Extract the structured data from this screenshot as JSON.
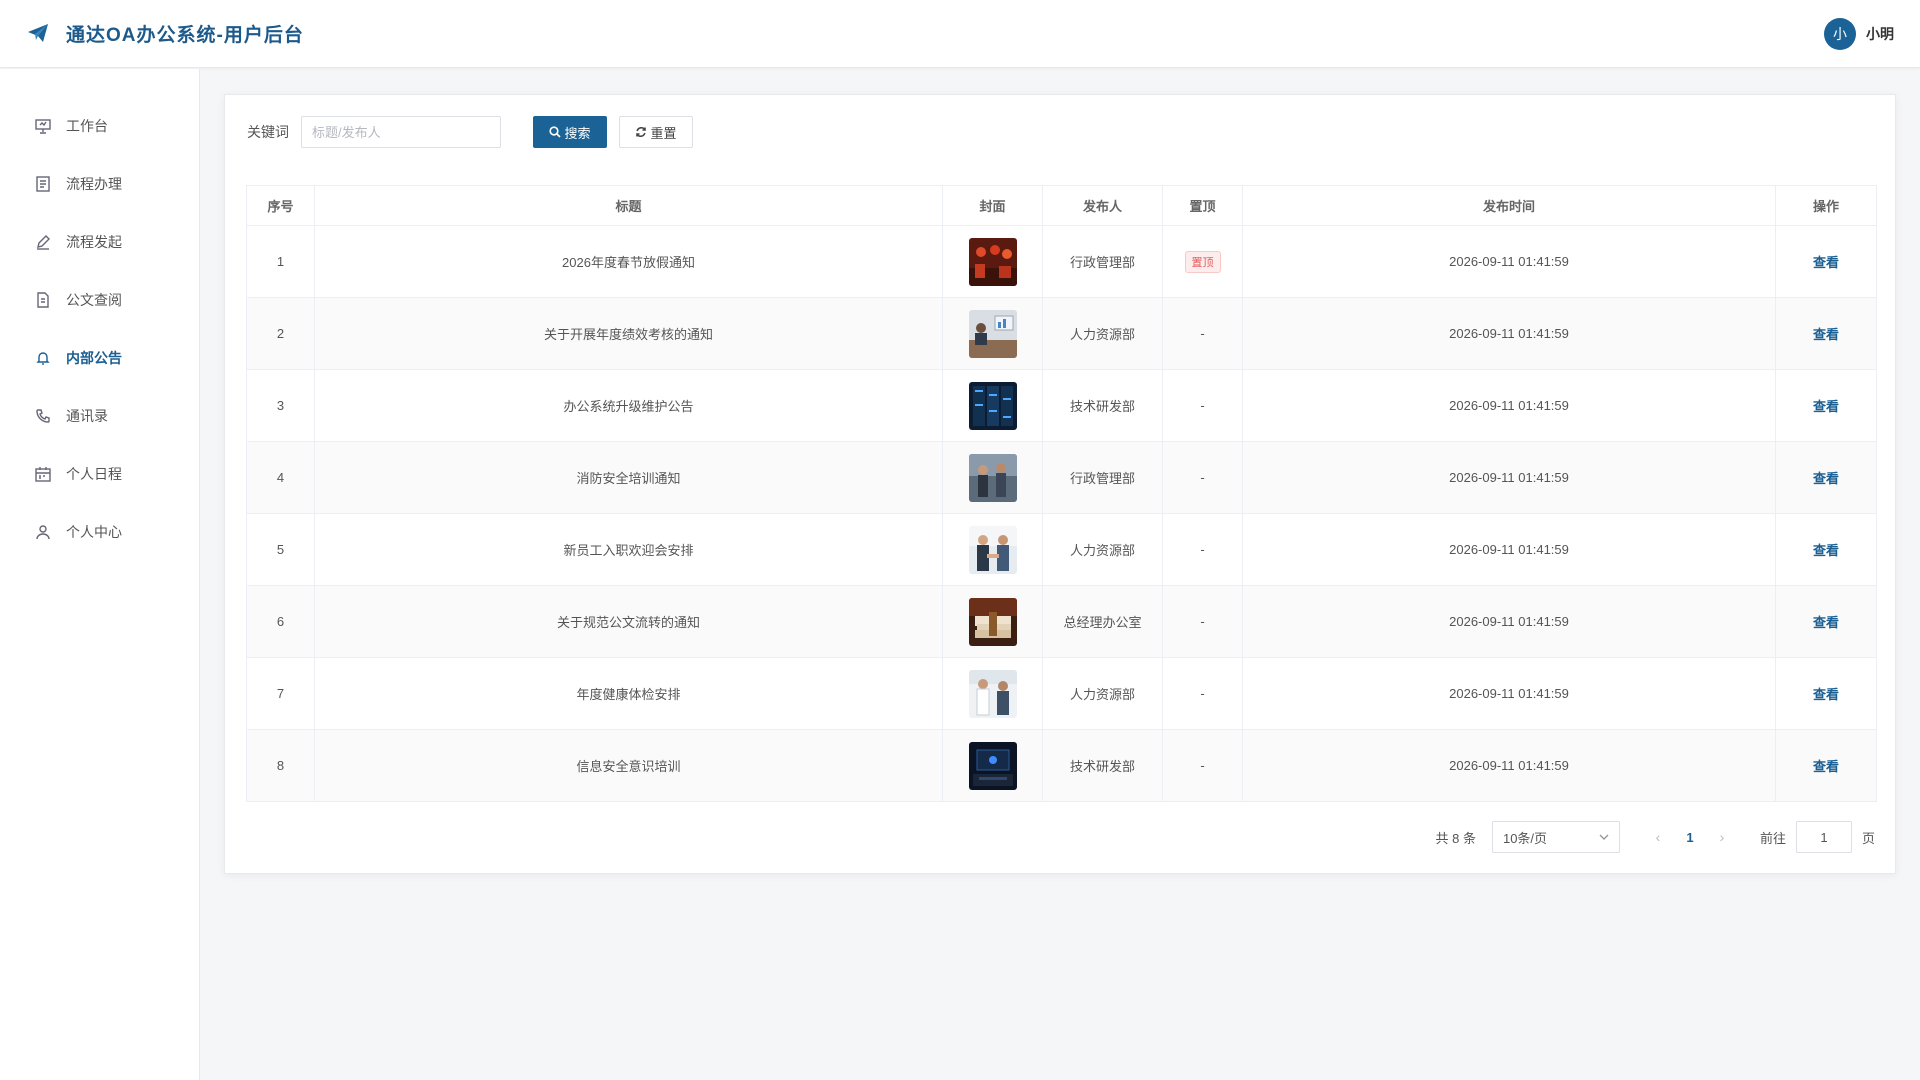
{
  "header": {
    "title": "通达OA办公系统-用户后台",
    "user_avatar_text": "小",
    "user_name": "小明"
  },
  "sidebar": {
    "items": [
      {
        "label": "工作台",
        "icon": "presentation-icon",
        "active": false
      },
      {
        "label": "流程办理",
        "icon": "document-list-icon",
        "active": false
      },
      {
        "label": "流程发起",
        "icon": "pen-icon",
        "active": false
      },
      {
        "label": "公文查阅",
        "icon": "file-icon",
        "active": false
      },
      {
        "label": "内部公告",
        "icon": "bell-icon",
        "active": true
      },
      {
        "label": "通讯录",
        "icon": "phone-icon",
        "active": false
      },
      {
        "label": "个人日程",
        "icon": "calendar-icon",
        "active": false
      },
      {
        "label": "个人中心",
        "icon": "user-icon",
        "active": false
      }
    ]
  },
  "search": {
    "label": "关键词",
    "placeholder": "标题/发布人",
    "value": "",
    "search_button": "搜索",
    "reset_button": "重置"
  },
  "table": {
    "columns": [
      "序号",
      "标题",
      "封面",
      "发布人",
      "置顶",
      "发布时间",
      "操作"
    ],
    "rows": [
      {
        "index": "1",
        "title": "2026年度春节放假通知",
        "publisher": "行政管理部",
        "pinned": "置顶",
        "is_pinned": true,
        "time": "2026-09-11 01:41:59",
        "action": "查看",
        "cover": "festival"
      },
      {
        "index": "2",
        "title": "关于开展年度绩效考核的通知",
        "publisher": "人力资源部",
        "pinned": "-",
        "is_pinned": false,
        "time": "2026-09-11 01:41:59",
        "action": "查看",
        "cover": "meeting"
      },
      {
        "index": "3",
        "title": "办公系统升级维护公告",
        "publisher": "技术研发部",
        "pinned": "-",
        "is_pinned": false,
        "time": "2026-09-11 01:41:59",
        "action": "查看",
        "cover": "server"
      },
      {
        "index": "4",
        "title": "消防安全培训通知",
        "publisher": "行政管理部",
        "pinned": "-",
        "is_pinned": false,
        "time": "2026-09-11 01:41:59",
        "action": "查看",
        "cover": "training"
      },
      {
        "index": "5",
        "title": "新员工入职欢迎会安排",
        "publisher": "人力资源部",
        "pinned": "-",
        "is_pinned": false,
        "time": "2026-09-11 01:41:59",
        "action": "查看",
        "cover": "handshake"
      },
      {
        "index": "6",
        "title": "关于规范公文流转的通知",
        "publisher": "总经理办公室",
        "pinned": "-",
        "is_pinned": false,
        "time": "2026-09-11 01:41:59",
        "action": "查看",
        "cover": "documents"
      },
      {
        "index": "7",
        "title": "年度健康体检安排",
        "publisher": "人力资源部",
        "pinned": "-",
        "is_pinned": false,
        "time": "2026-09-11 01:41:59",
        "action": "查看",
        "cover": "medical"
      },
      {
        "index": "8",
        "title": "信息安全意识培训",
        "publisher": "技术研发部",
        "pinned": "-",
        "is_pinned": false,
        "time": "2026-09-11 01:41:59",
        "action": "查看",
        "cover": "security"
      }
    ]
  },
  "pagination": {
    "total": "共 8 条",
    "page_size": "10条/页",
    "current_page": "1",
    "goto_label": "前往",
    "goto_value": "1",
    "page_unit": "页"
  },
  "colors": {
    "primary": "#1b6396",
    "brand_text": "#1d5a8c",
    "pin_badge": "#e35b5b"
  }
}
